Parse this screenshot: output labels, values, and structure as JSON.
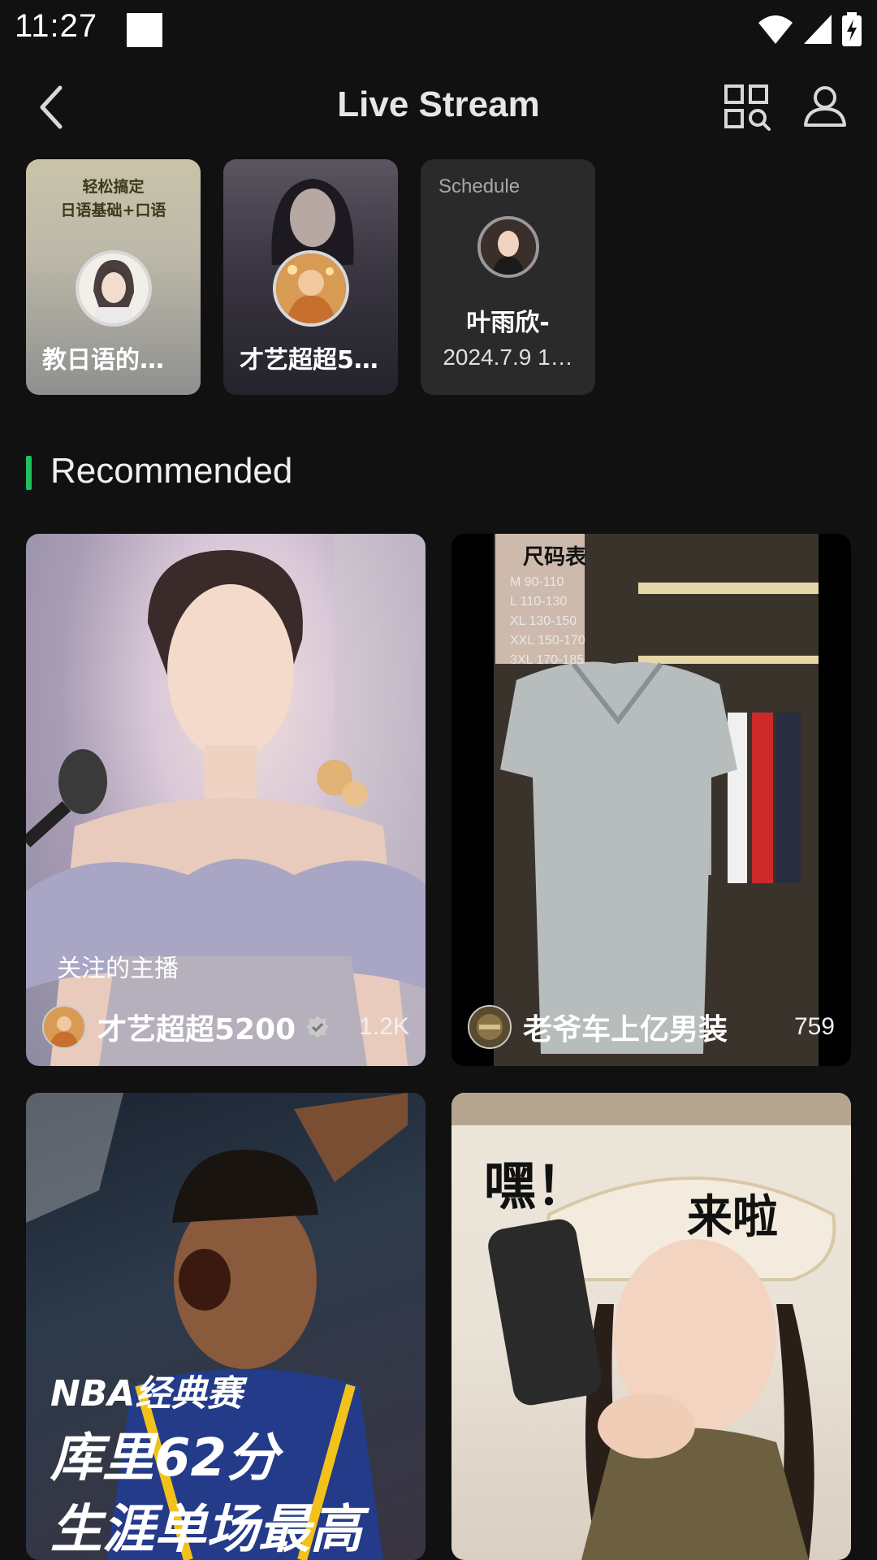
{
  "status_bar": {
    "time": "11:27"
  },
  "header": {
    "title": "Live Stream"
  },
  "stories": [
    {
      "banner_line1": "轻松搞定",
      "banner_line2": "日语基础+口语",
      "name": "教日语的…"
    },
    {
      "name": "才艺超超5…"
    },
    {
      "schedule_label": "Schedule",
      "name": "叶雨欣-",
      "time": "2024.7.9 1…"
    }
  ],
  "recommended": {
    "title": "Recommended",
    "cards": [
      {
        "tag": "关注的主播",
        "name": "才艺超超5200",
        "count": "1.2K",
        "verified": true
      },
      {
        "name": "老爷车上亿男装",
        "count": "759",
        "overlay": [
          "尺码表",
          "M 90-110",
          "L 110-130",
          "XL 130-150",
          "XXL 150-170",
          "3XL 170-185"
        ]
      },
      {
        "overlay": [
          "NBA经典赛",
          "库里62分",
          "生涯单场最高"
        ]
      },
      {
        "overlay": [
          "嘿！",
          "来啦"
        ]
      }
    ]
  },
  "colors": {
    "accent": "#20c060",
    "background": "#111111"
  }
}
